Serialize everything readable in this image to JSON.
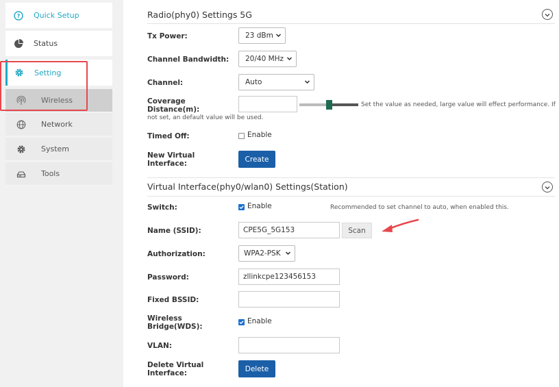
{
  "sidebar": {
    "quick_setup": "Quick Setup",
    "status": "Status",
    "setting": "Setting",
    "sub_items": {
      "wireless": "Wireless",
      "network": "Network",
      "system": "System",
      "tools": "Tools"
    }
  },
  "radio_section": {
    "title": "Radio(phy0) Settings 5G",
    "tx_power_label": "Tx Power:",
    "tx_power_value": "23 dBm",
    "channel_bandwidth_label": "Channel Bandwidth:",
    "channel_bandwidth_value": "20/40 MHz",
    "channel_label": "Channel:",
    "channel_value": "Auto",
    "coverage_label_line1": "Coverage",
    "coverage_label_line2": "Distance(m):",
    "coverage_value": "",
    "coverage_note_line1": "Set the value as needed, large value will effect performance. If",
    "coverage_note_line2": "not set, an default value will be used.",
    "timed_off_label": "Timed Off:",
    "timed_off_option": "Enable",
    "new_virtual_label_line1": "New Virtual",
    "new_virtual_label_line2": "Interface:",
    "create_button": "Create"
  },
  "virtual_section": {
    "title": "Virtual Interface(phy0/wlan0) Settings(Station)",
    "switch_label": "Switch:",
    "switch_option": "Enable",
    "switch_note": "Recommended to set channel to auto, when enabled this.",
    "ssid_label": "Name (SSID):",
    "ssid_value": "CPE5G_5G153",
    "scan_button": "Scan",
    "authorization_label": "Authorization:",
    "authorization_value": "WPA2-PSK",
    "password_label": "Password:",
    "password_value": "zllinkcpe123456153",
    "fixed_bssid_label": "Fixed BSSID:",
    "fixed_bssid_value": "",
    "wds_label_line1": "Wireless",
    "wds_label_line2": "Bridge(WDS):",
    "wds_option": "Enable",
    "vlan_label": "VLAN:",
    "vlan_value": "",
    "delete_virtual_label_line1": "Delete Virtual",
    "delete_virtual_label_line2": "Interface:",
    "delete_button": "Delete"
  },
  "colors": {
    "accent": "#21a8c4",
    "primary_button": "#1a5fa8",
    "highlight_box": "#e8474c",
    "annotation_arrow": "#e8474c"
  }
}
